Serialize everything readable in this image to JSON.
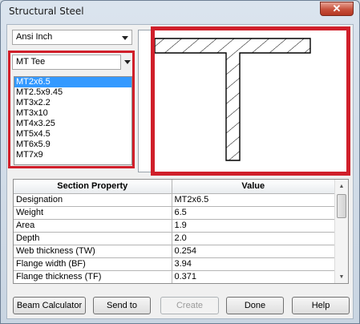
{
  "window": {
    "title": "Structural Steel",
    "close_glyph": "✕"
  },
  "standard_select": {
    "value": "Ansi Inch"
  },
  "shape_select": {
    "value": "MT Tee"
  },
  "shapes_list": [
    "MT2x6.5",
    "MT2.5x9.45",
    "MT3x2.2",
    "MT3x10",
    "MT4x3.25",
    "MT5x4.5",
    "MT6x5.9",
    "MT7x9"
  ],
  "selected_index": 0,
  "preview": {
    "shape": "tee-section"
  },
  "properties_table": {
    "headers": [
      "Section Property",
      "Value"
    ],
    "rows": [
      [
        "Designation",
        "MT2x6.5"
      ],
      [
        "Weight",
        "6.5"
      ],
      [
        "Area",
        "1.9"
      ],
      [
        "Depth",
        "2.0"
      ],
      [
        "Web thickness (TW)",
        "0.254"
      ],
      [
        "Flange width (BF)",
        "3.94"
      ],
      [
        "Flange thickness (TF)",
        "0.371"
      ]
    ]
  },
  "buttons": {
    "beam_calculator": "Beam Calculator",
    "send_to": "Send to",
    "create": "Create",
    "done": "Done",
    "help": "Help"
  },
  "colors": {
    "highlight": "#d01f2a",
    "selection": "#3399ff"
  }
}
